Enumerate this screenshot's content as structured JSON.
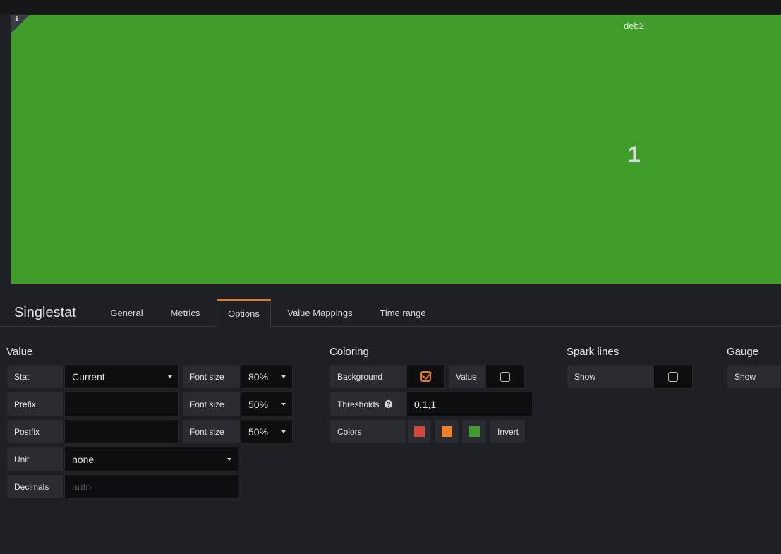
{
  "panel": {
    "info_glyph": "i",
    "title": "deb2",
    "value": "1",
    "background_color": "#3f9e2a"
  },
  "editor": {
    "title": "Singlestat",
    "tabs": [
      {
        "label": "General",
        "active": false
      },
      {
        "label": "Metrics",
        "active": false
      },
      {
        "label": "Options",
        "active": true
      },
      {
        "label": "Value Mappings",
        "active": false
      },
      {
        "label": "Time range",
        "active": false
      }
    ],
    "accent_color": "#eb7b18"
  },
  "value_section": {
    "title": "Value",
    "stat_label": "Stat",
    "stat_value": "Current",
    "prefix_label": "Prefix",
    "prefix_value": "",
    "postfix_label": "Postfix",
    "postfix_value": "",
    "font_size_label": "Font size",
    "value_font_size": "80%",
    "prefix_font_size": "50%",
    "postfix_font_size": "50%",
    "unit_label": "Unit",
    "unit_value": "none",
    "decimals_label": "Decimals",
    "decimals_placeholder": "auto"
  },
  "coloring_section": {
    "title": "Coloring",
    "background_label": "Background",
    "background_checked": true,
    "value_label": "Value",
    "value_checked": false,
    "thresholds_label": "Thresholds",
    "help_glyph": "?",
    "thresholds_value": "0.1,1",
    "colors_label": "Colors",
    "colors": [
      "#d44a3a",
      "#ed8128",
      "#3f9e2a"
    ],
    "invert_label": "Invert"
  },
  "spark_section": {
    "title": "Spark lines",
    "show_label": "Show",
    "show_checked": false
  },
  "gauge_section": {
    "title": "Gauge",
    "show_label": "Show"
  }
}
